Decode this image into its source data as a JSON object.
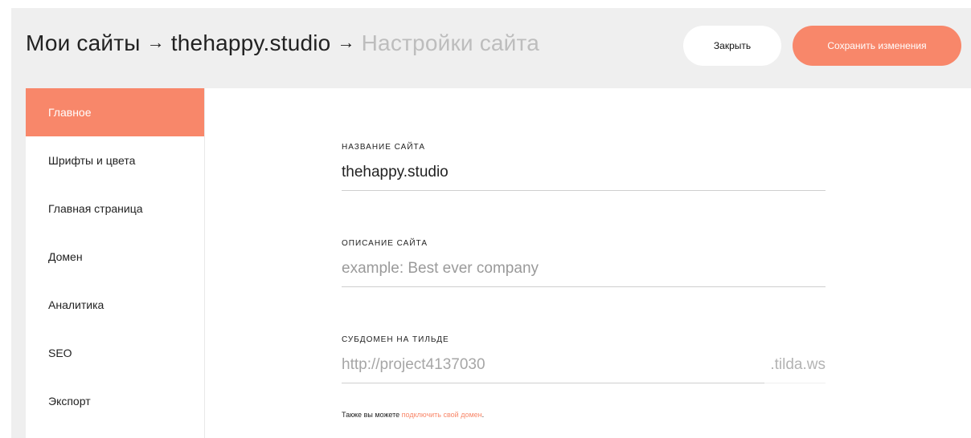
{
  "header": {
    "breadcrumb": {
      "my_sites": "Мои сайты",
      "separator": "→",
      "site": "thehappy.studio",
      "current": "Настройки сайта"
    },
    "close_label": "Закрыть",
    "save_label": "Сохранить изменения"
  },
  "sidebar": {
    "items": [
      {
        "label": "Главное",
        "active": true
      },
      {
        "label": "Шрифты и цвета"
      },
      {
        "label": "Главная страница"
      },
      {
        "label": "Домен"
      },
      {
        "label": "Аналитика"
      },
      {
        "label": "SEO"
      },
      {
        "label": "Экспорт"
      }
    ]
  },
  "form": {
    "site_name": {
      "label": "НАЗВАНИЕ САЙТА",
      "value": "thehappy.studio"
    },
    "site_description": {
      "label": "ОПИСАНИЕ САЙТА",
      "value": "",
      "placeholder": "example: Best ever company"
    },
    "subdomain": {
      "label": "СУБДОМЕН НА ТИЛЬДЕ",
      "value": "http://project4137030",
      "suffix": ".tilda.ws"
    },
    "hint": {
      "text": "Также вы можете ",
      "link": "подключить свой домен",
      "end": "."
    }
  },
  "colors": {
    "accent": "#f8876a",
    "header_bg": "#efefef"
  }
}
